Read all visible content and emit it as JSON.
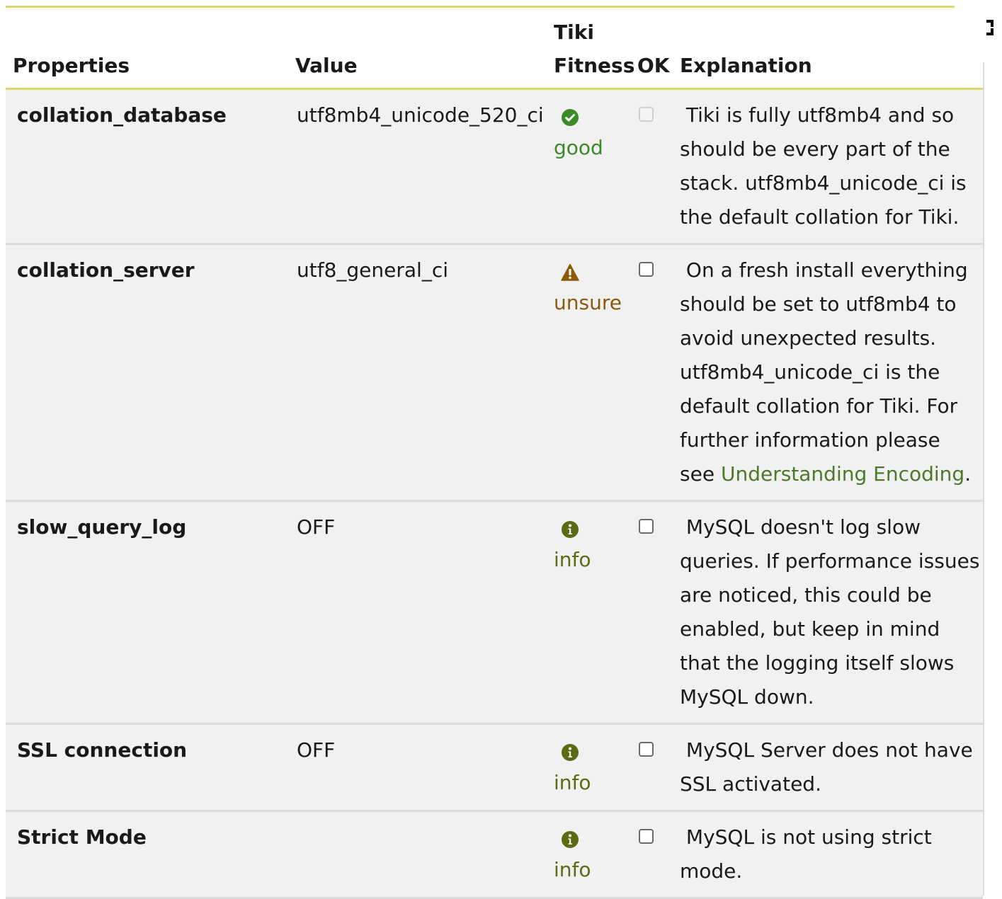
{
  "table": {
    "headers": {
      "properties": "Properties",
      "value": "Value",
      "fitness_line1": "Tiki",
      "fitness_line2": "Fitness",
      "ok": "OK",
      "explanation": "Explanation"
    },
    "rows": [
      {
        "property": "collation_database",
        "value": "utf8mb4_unicode_520_ci",
        "fitness": "good",
        "fitness_icon": "check-circle-icon",
        "ok_enabled": false,
        "explanation": "Tiki is fully utf8mb4 and so should be every part of the stack. utf8mb4_unicode_ci is the default collation for Tiki."
      },
      {
        "property": "collation_server",
        "value": "utf8_general_ci",
        "fitness": "unsure",
        "fitness_icon": "warning-triangle-icon",
        "ok_enabled": true,
        "explanation": "On a fresh install everything should be set to utf8mb4 to avoid unexpected results. utf8mb4_unicode_ci is the default collation for Tiki. For further information please see",
        "explanation_link": "Understanding Encoding",
        "explanation_end": "."
      },
      {
        "property": "slow_query_log",
        "value": "OFF",
        "fitness": "info",
        "fitness_icon": "info-circle-icon",
        "ok_enabled": true,
        "explanation": "MySQL doesn't log slow queries. If performance issues are noticed, this could be enabled, but keep in mind that the logging itself slows MySQL down."
      },
      {
        "property": "SSL connection",
        "value": "OFF",
        "fitness": "info",
        "fitness_icon": "info-circle-icon",
        "ok_enabled": true,
        "explanation": "MySQL Server does not have SSL activated."
      },
      {
        "property": "Strict Mode",
        "value": "",
        "fitness": "info",
        "fitness_icon": "info-circle-icon",
        "ok_enabled": true,
        "explanation": "MySQL is not using strict mode."
      }
    ]
  },
  "colors": {
    "header_rule": "#dcd96a",
    "row_bg": "#f1f1f1",
    "good": "#3b8a28",
    "unsure": "#8c5a0a",
    "info": "#5b6b12",
    "link": "#4c7a2a"
  },
  "controls": {
    "expand_icon": "fullscreen-expand-icon"
  }
}
